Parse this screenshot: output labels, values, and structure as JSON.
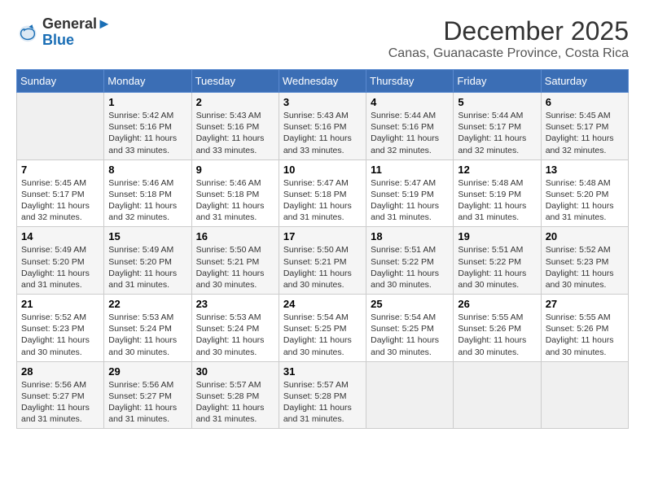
{
  "logo": {
    "line1": "General",
    "line2": "Blue"
  },
  "title": "December 2025",
  "subtitle": "Canas, Guanacaste Province, Costa Rica",
  "header": {
    "days": [
      "Sunday",
      "Monday",
      "Tuesday",
      "Wednesday",
      "Thursday",
      "Friday",
      "Saturday"
    ]
  },
  "weeks": [
    [
      {
        "num": "",
        "info": ""
      },
      {
        "num": "1",
        "info": "Sunrise: 5:42 AM\nSunset: 5:16 PM\nDaylight: 11 hours and 33 minutes."
      },
      {
        "num": "2",
        "info": "Sunrise: 5:43 AM\nSunset: 5:16 PM\nDaylight: 11 hours and 33 minutes."
      },
      {
        "num": "3",
        "info": "Sunrise: 5:43 AM\nSunset: 5:16 PM\nDaylight: 11 hours and 33 minutes."
      },
      {
        "num": "4",
        "info": "Sunrise: 5:44 AM\nSunset: 5:16 PM\nDaylight: 11 hours and 32 minutes."
      },
      {
        "num": "5",
        "info": "Sunrise: 5:44 AM\nSunset: 5:17 PM\nDaylight: 11 hours and 32 minutes."
      },
      {
        "num": "6",
        "info": "Sunrise: 5:45 AM\nSunset: 5:17 PM\nDaylight: 11 hours and 32 minutes."
      }
    ],
    [
      {
        "num": "7",
        "info": "Sunrise: 5:45 AM\nSunset: 5:17 PM\nDaylight: 11 hours and 32 minutes."
      },
      {
        "num": "8",
        "info": "Sunrise: 5:46 AM\nSunset: 5:18 PM\nDaylight: 11 hours and 32 minutes."
      },
      {
        "num": "9",
        "info": "Sunrise: 5:46 AM\nSunset: 5:18 PM\nDaylight: 11 hours and 31 minutes."
      },
      {
        "num": "10",
        "info": "Sunrise: 5:47 AM\nSunset: 5:18 PM\nDaylight: 11 hours and 31 minutes."
      },
      {
        "num": "11",
        "info": "Sunrise: 5:47 AM\nSunset: 5:19 PM\nDaylight: 11 hours and 31 minutes."
      },
      {
        "num": "12",
        "info": "Sunrise: 5:48 AM\nSunset: 5:19 PM\nDaylight: 11 hours and 31 minutes."
      },
      {
        "num": "13",
        "info": "Sunrise: 5:48 AM\nSunset: 5:20 PM\nDaylight: 11 hours and 31 minutes."
      }
    ],
    [
      {
        "num": "14",
        "info": "Sunrise: 5:49 AM\nSunset: 5:20 PM\nDaylight: 11 hours and 31 minutes."
      },
      {
        "num": "15",
        "info": "Sunrise: 5:49 AM\nSunset: 5:20 PM\nDaylight: 11 hours and 31 minutes."
      },
      {
        "num": "16",
        "info": "Sunrise: 5:50 AM\nSunset: 5:21 PM\nDaylight: 11 hours and 30 minutes."
      },
      {
        "num": "17",
        "info": "Sunrise: 5:50 AM\nSunset: 5:21 PM\nDaylight: 11 hours and 30 minutes."
      },
      {
        "num": "18",
        "info": "Sunrise: 5:51 AM\nSunset: 5:22 PM\nDaylight: 11 hours and 30 minutes."
      },
      {
        "num": "19",
        "info": "Sunrise: 5:51 AM\nSunset: 5:22 PM\nDaylight: 11 hours and 30 minutes."
      },
      {
        "num": "20",
        "info": "Sunrise: 5:52 AM\nSunset: 5:23 PM\nDaylight: 11 hours and 30 minutes."
      }
    ],
    [
      {
        "num": "21",
        "info": "Sunrise: 5:52 AM\nSunset: 5:23 PM\nDaylight: 11 hours and 30 minutes."
      },
      {
        "num": "22",
        "info": "Sunrise: 5:53 AM\nSunset: 5:24 PM\nDaylight: 11 hours and 30 minutes."
      },
      {
        "num": "23",
        "info": "Sunrise: 5:53 AM\nSunset: 5:24 PM\nDaylight: 11 hours and 30 minutes."
      },
      {
        "num": "24",
        "info": "Sunrise: 5:54 AM\nSunset: 5:25 PM\nDaylight: 11 hours and 30 minutes."
      },
      {
        "num": "25",
        "info": "Sunrise: 5:54 AM\nSunset: 5:25 PM\nDaylight: 11 hours and 30 minutes."
      },
      {
        "num": "26",
        "info": "Sunrise: 5:55 AM\nSunset: 5:26 PM\nDaylight: 11 hours and 30 minutes."
      },
      {
        "num": "27",
        "info": "Sunrise: 5:55 AM\nSunset: 5:26 PM\nDaylight: 11 hours and 30 minutes."
      }
    ],
    [
      {
        "num": "28",
        "info": "Sunrise: 5:56 AM\nSunset: 5:27 PM\nDaylight: 11 hours and 31 minutes."
      },
      {
        "num": "29",
        "info": "Sunrise: 5:56 AM\nSunset: 5:27 PM\nDaylight: 11 hours and 31 minutes."
      },
      {
        "num": "30",
        "info": "Sunrise: 5:57 AM\nSunset: 5:28 PM\nDaylight: 11 hours and 31 minutes."
      },
      {
        "num": "31",
        "info": "Sunrise: 5:57 AM\nSunset: 5:28 PM\nDaylight: 11 hours and 31 minutes."
      },
      {
        "num": "",
        "info": ""
      },
      {
        "num": "",
        "info": ""
      },
      {
        "num": "",
        "info": ""
      }
    ]
  ]
}
